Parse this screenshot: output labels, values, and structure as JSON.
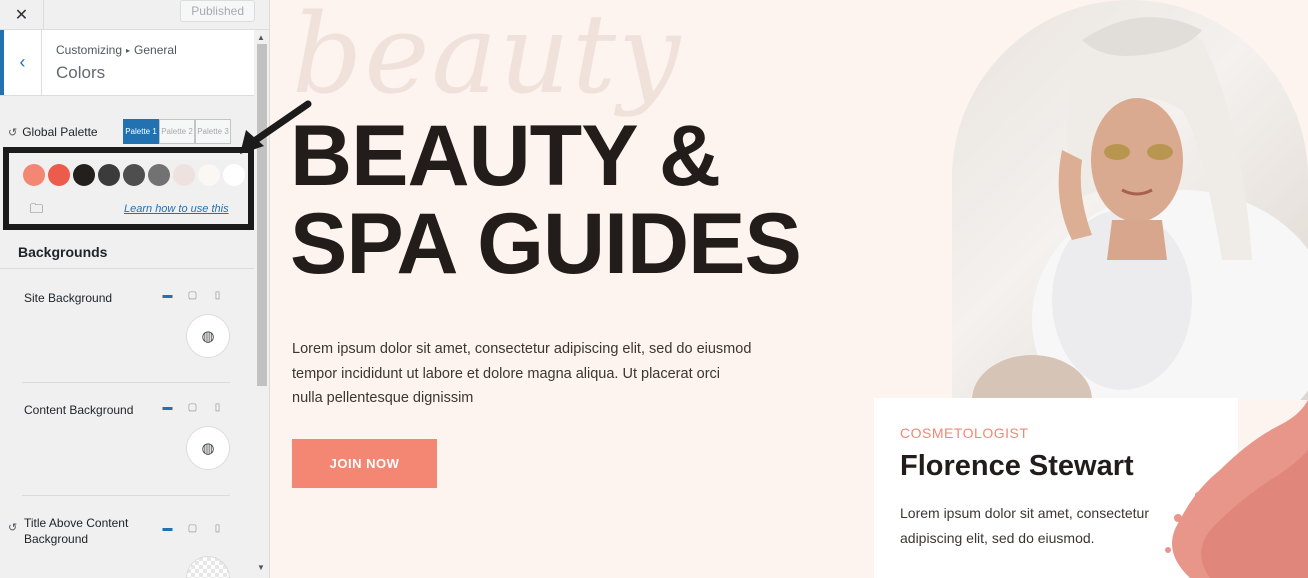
{
  "topbar": {
    "close_icon": "close-icon",
    "publish_label": "Published"
  },
  "section": {
    "crumb_root": "Customizing",
    "crumb_parent": "General",
    "title": "Colors"
  },
  "global_palette": {
    "label": "Global Palette",
    "tabs": [
      "Palette 1",
      "Palette 2",
      "Palette 3"
    ],
    "active_tab": "Palette 1",
    "swatches": [
      "#f48674",
      "#ec5b4c",
      "#231f1c",
      "#3b3b3b",
      "#4e4e4e",
      "#727272",
      "#ede2de",
      "#fbf7f2",
      "#ffffff"
    ],
    "learn_link": "Learn how to use this"
  },
  "backgrounds": {
    "title": "Backgrounds",
    "settings": [
      {
        "label": "Site Background"
      },
      {
        "label": "Content Background"
      },
      {
        "label": "Title Above Content Background"
      }
    ]
  },
  "hero": {
    "script_word": "beauty",
    "title_line1": "BEAUTY &",
    "title_line2": "SPA GUIDES",
    "description": "Lorem ipsum dolor sit amet, consectetur adipiscing elit, sed do eiusmod tempor incididunt ut labore et dolore magna aliqua. Ut placerat orci nulla pellentesque dignissim",
    "button_label": "JOIN NOW"
  },
  "card": {
    "role": "COSMETOLOGIST",
    "name": "Florence Stewart",
    "description": "Lorem ipsum dolor sit amet, consectetur adipiscing elit, sed do eiusmod."
  },
  "colors": {
    "accent": "#2271b1",
    "brand_coral": "#f48674",
    "heading": "#221d1a",
    "preview_bg": "#fdf3ef"
  }
}
